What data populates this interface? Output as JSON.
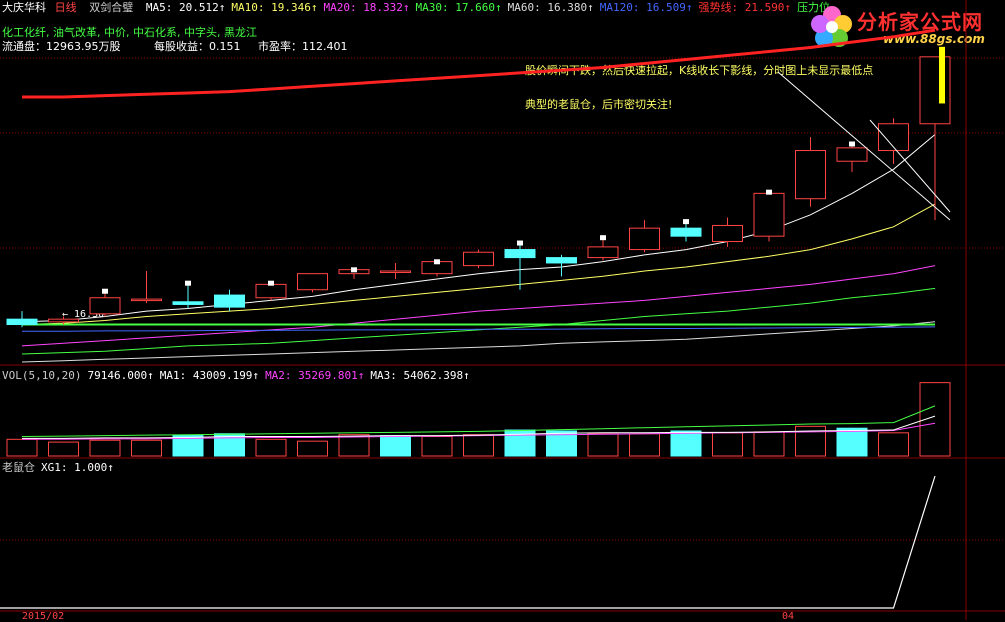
{
  "header": {
    "stock_name": "大庆华科",
    "period": "日线",
    "indicator_name": "双剑合璧",
    "ma": [
      {
        "label": "MA5: 20.512↑",
        "color": "#ffffff"
      },
      {
        "label": "MA10: 19.346↑",
        "color": "#ffff66"
      },
      {
        "label": "MA20: 18.332↑",
        "color": "#ff44ff"
      },
      {
        "label": "MA30: 17.660↑",
        "color": "#44ff44"
      },
      {
        "label": "MA60: 16.380↑",
        "color": "#dddddd"
      },
      {
        "label": "MA120: 16.509↑",
        "color": "#4466ff"
      },
      {
        "label": "强势线: 21.590↑",
        "color": "#ff3333"
      },
      {
        "label": "压力位",
        "color": "#44ff44"
      }
    ],
    "concepts": "化工化纤, 油气改革, 中价, 中石化系, 中字头, 黑龙江",
    "float_shares": "流通盘：12963.95万股",
    "eps": "每股收益：0.151",
    "pe": "市盈率：112.401"
  },
  "annotations": {
    "line1": "股价瞬间下跌，然后快速拉起，K线收长下影线，分时图上未显示最低点",
    "line2": "典型的老鼠仓，后市密切关注!"
  },
  "price_low_label": "← 16.30",
  "volume_header": [
    {
      "label": "VOL(5,10,20)",
      "color": "#cccccc"
    },
    {
      "label": "79146.000↑",
      "color": "#ffffff"
    },
    {
      "label": "MA1: 43009.199↑",
      "color": "#ffffff"
    },
    {
      "label": "MA2: 35269.801↑",
      "color": "#ff44ff"
    },
    {
      "label": "MA3: 54062.398↑",
      "color": "#ffffff"
    }
  ],
  "indicator_header": [
    {
      "label": "老鼠仓",
      "color": "#cccccc"
    },
    {
      "label": "XG1: 1.000↑",
      "color": "#ffffff"
    }
  ],
  "logo": {
    "text": "分析家公式网",
    "url": "www.88gs.com"
  },
  "date_labels": [
    "2015/02",
    "04"
  ],
  "colors": {
    "up": "#ff4444",
    "down": "#55ffff",
    "grid": "#880000",
    "bg": "#000000"
  },
  "chart_data": {
    "type": "candlestick",
    "candles": [
      {
        "o": 16.6,
        "h": 16.9,
        "l": 16.3,
        "c": 16.4
      },
      {
        "o": 16.5,
        "h": 16.7,
        "l": 16.4,
        "c": 16.6
      },
      {
        "o": 16.8,
        "h": 17.7,
        "l": 16.7,
        "c": 17.4
      },
      {
        "o": 17.3,
        "h": 18.4,
        "l": 17.2,
        "c": 17.35
      },
      {
        "o": 17.25,
        "h": 18.0,
        "l": 17.0,
        "c": 17.15
      },
      {
        "o": 17.5,
        "h": 17.7,
        "l": 16.9,
        "c": 17.05
      },
      {
        "o": 17.4,
        "h": 18.0,
        "l": 17.3,
        "c": 17.9
      },
      {
        "o": 17.7,
        "h": 18.3,
        "l": 17.6,
        "c": 18.3
      },
      {
        "o": 18.3,
        "h": 18.5,
        "l": 18.1,
        "c": 18.45
      },
      {
        "o": 18.4,
        "h": 18.7,
        "l": 18.1,
        "c": 18.4
      },
      {
        "o": 18.3,
        "h": 18.8,
        "l": 18.2,
        "c": 18.75
      },
      {
        "o": 18.6,
        "h": 19.2,
        "l": 18.5,
        "c": 19.1
      },
      {
        "o": 19.2,
        "h": 19.5,
        "l": 17.7,
        "c": 18.9
      },
      {
        "o": 18.9,
        "h": 19.0,
        "l": 18.2,
        "c": 18.7
      },
      {
        "o": 18.9,
        "h": 19.7,
        "l": 18.8,
        "c": 19.3
      },
      {
        "o": 19.2,
        "h": 20.3,
        "l": 19.1,
        "c": 20.0
      },
      {
        "o": 20.0,
        "h": 20.3,
        "l": 19.5,
        "c": 19.7
      },
      {
        "o": 19.5,
        "h": 20.4,
        "l": 19.3,
        "c": 20.1
      },
      {
        "o": 19.7,
        "h": 21.4,
        "l": 19.5,
        "c": 21.3
      },
      {
        "o": 21.1,
        "h": 23.4,
        "l": 20.8,
        "c": 22.9
      },
      {
        "o": 22.5,
        "h": 23.2,
        "l": 22.1,
        "c": 23.0
      },
      {
        "o": 22.9,
        "h": 24.1,
        "l": 22.4,
        "c": 23.9
      },
      {
        "o": 23.9,
        "h": 26.4,
        "l": 20.3,
        "c": 26.4
      }
    ],
    "ma5": [
      16.5,
      16.55,
      16.7,
      16.9,
      17.0,
      17.15,
      17.3,
      17.45,
      17.7,
      17.9,
      18.1,
      18.3,
      18.45,
      18.55,
      18.75,
      19.0,
      19.2,
      19.5,
      19.9,
      20.5,
      21.3,
      22.2,
      23.5
    ],
    "ma10": [
      16.4,
      16.45,
      16.55,
      16.7,
      16.8,
      16.9,
      17.0,
      17.15,
      17.3,
      17.45,
      17.6,
      17.75,
      17.9,
      18.05,
      18.2,
      18.4,
      18.55,
      18.75,
      18.95,
      19.2,
      19.6,
      20.05,
      20.9
    ],
    "ma20": [
      15.6,
      15.7,
      15.8,
      15.9,
      16.0,
      16.1,
      16.2,
      16.3,
      16.45,
      16.6,
      16.75,
      16.9,
      17.0,
      17.1,
      17.2,
      17.3,
      17.45,
      17.6,
      17.75,
      17.9,
      18.1,
      18.3,
      18.6
    ],
    "ma30": [
      15.3,
      15.35,
      15.4,
      15.5,
      15.6,
      15.65,
      15.7,
      15.8,
      15.9,
      16.0,
      16.1,
      16.2,
      16.3,
      16.4,
      16.55,
      16.7,
      16.8,
      16.9,
      17.05,
      17.2,
      17.4,
      17.55,
      17.75
    ],
    "ma60": [
      15.0,
      15.05,
      15.1,
      15.15,
      15.2,
      15.25,
      15.3,
      15.35,
      15.4,
      15.45,
      15.5,
      15.55,
      15.6,
      15.7,
      15.75,
      15.8,
      15.85,
      15.95,
      16.05,
      16.15,
      16.25,
      16.35,
      16.5
    ],
    "ma120": [
      16.15,
      16.15,
      16.16,
      16.16,
      16.17,
      16.18,
      16.18,
      16.19,
      16.2,
      16.2,
      16.21,
      16.22,
      16.22,
      16.23,
      16.24,
      16.25,
      16.25,
      16.26,
      16.27,
      16.28,
      16.29,
      16.3,
      16.31
    ],
    "strong_line": [
      24.9,
      24.9,
      24.95,
      25.0,
      25.05,
      25.1,
      25.2,
      25.3,
      25.4,
      25.5,
      25.6,
      25.7,
      25.8,
      25.9,
      26.0,
      26.15,
      26.3,
      26.45,
      26.6,
      26.75,
      26.95,
      27.15,
      27.4
    ],
    "pressure_line": [
      16.4,
      16.4,
      16.4,
      16.4,
      16.4,
      16.4,
      16.4,
      16.4,
      16.4,
      16.4,
      16.4,
      16.4,
      16.4,
      16.4,
      16.4,
      16.4,
      16.4,
      16.4,
      16.4,
      16.4,
      16.4,
      16.4,
      16.4
    ],
    "ylim": [
      15.0,
      28.0
    ],
    "volume": {
      "values": [
        18000,
        15000,
        17000,
        17000,
        22000,
        24000,
        18000,
        16000,
        23000,
        22000,
        21000,
        23000,
        28000,
        27000,
        24000,
        24000,
        27000,
        25000,
        26000,
        32000,
        30000,
        25000,
        79146
      ],
      "up": [
        true,
        true,
        true,
        true,
        false,
        false,
        true,
        true,
        true,
        false,
        true,
        true,
        false,
        false,
        true,
        true,
        false,
        true,
        true,
        true,
        false,
        true,
        true
      ],
      "ma1": [
        19000,
        19000,
        19500,
        19500,
        20000,
        21000,
        21000,
        21000,
        21500,
        22000,
        22000,
        22500,
        23500,
        24500,
        25000,
        25000,
        25500,
        25500,
        26000,
        27000,
        27500,
        28000,
        43009
      ],
      "ma2": [
        18000,
        18000,
        18500,
        18500,
        19000,
        19500,
        20000,
        20000,
        20500,
        21000,
        21500,
        22000,
        22500,
        23000,
        23500,
        24000,
        24500,
        25000,
        25500,
        26000,
        26500,
        27500,
        35270
      ],
      "ma3": [
        21000,
        21500,
        22000,
        22500,
        23000,
        23500,
        24000,
        24500,
        25000,
        25500,
        26000,
        26500,
        27500,
        28500,
        29500,
        30500,
        31500,
        32500,
        33500,
        34500,
        35000,
        36000,
        54062
      ],
      "ylim": [
        0,
        82000
      ]
    },
    "indicator": {
      "name": "XG1",
      "values": [
        0,
        0,
        0,
        0,
        0,
        0,
        0,
        0,
        0,
        0,
        0,
        0,
        0,
        0,
        0,
        0,
        0,
        0,
        0,
        0,
        0,
        0,
        1
      ],
      "ylim": [
        0,
        1.0
      ]
    }
  }
}
